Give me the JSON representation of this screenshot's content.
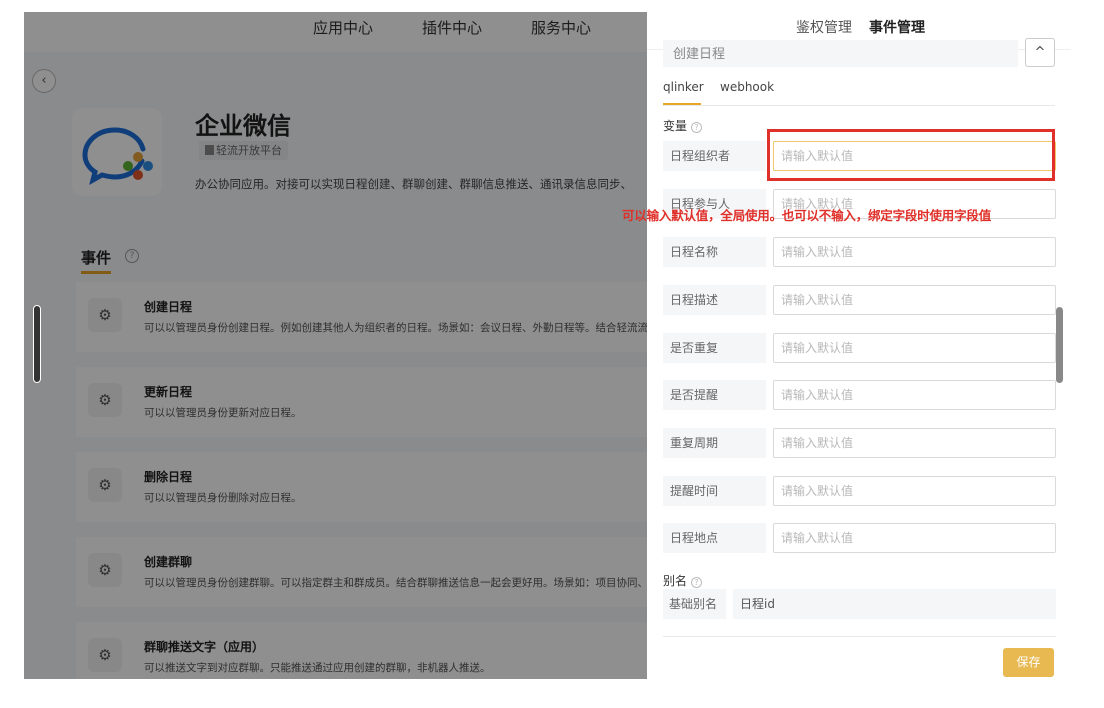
{
  "left": {
    "nav": [
      "应用中心",
      "插件中心",
      "服务中心"
    ],
    "back_glyph": "‹",
    "app_title": "企业微信",
    "app_badge": "轻流开放平台",
    "app_desc": "办公协同应用。对接可以实现日程创建、群聊创建、群聊信息推送、通讯录信息同步、",
    "events_title": "事件",
    "events_help": "?",
    "events": [
      {
        "name": "创建日程",
        "desc": "可以以管理员身份创建日程。例如创建其他人为组织者的日程。场景如：会议日程、外勤日程等。结合轻流流程"
      },
      {
        "name": "更新日程",
        "desc": "可以以管理员身份更新对应日程。"
      },
      {
        "name": "删除日程",
        "desc": "可以以管理员身份删除对应日程。"
      },
      {
        "name": "创建群聊",
        "desc": "可以以管理员身份创建群聊。可以指定群主和群成员。结合群聊推送信息一起会更好用。场景如：项目协同、研"
      },
      {
        "name": "群聊推送文字（应用）",
        "desc": "可以推送文字到对应群聊。只能推送通过应用创建的群聊，非机器人推送。"
      }
    ],
    "event_icon_glyph": "⚙"
  },
  "drawer": {
    "tabs": [
      "鉴权管理",
      "事件管理"
    ],
    "active_tab": "事件管理",
    "event_select_value": "创建日程",
    "collapse_glyph": "^",
    "subtabs": [
      "qlinker",
      "webhook"
    ],
    "vars_label": "变量",
    "help_glyph": "?",
    "placeholder": "请输入默认值",
    "variables": [
      "日程组织者",
      "日程参与人",
      "日程名称",
      "日程描述",
      "是否重复",
      "是否提醒",
      "重复周期",
      "提醒时间",
      "日程地点"
    ],
    "alias_section_label": "别名",
    "alias_label": "基础别名",
    "alias_value": "日程id",
    "save_label": "保存"
  },
  "annotation": {
    "text": "可以输入默认值，全局使用。也可以不输入，绑定字段时使用字段值",
    "color": "#e0302a"
  },
  "colors": {
    "accent": "#e8a52a",
    "save": "#e8b950",
    "annotation": "#e0302a"
  }
}
